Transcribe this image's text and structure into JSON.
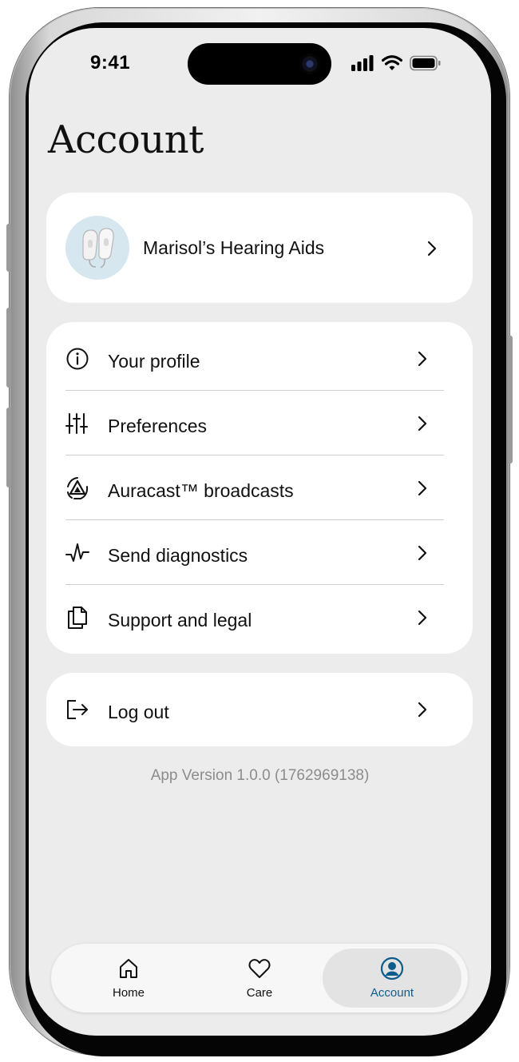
{
  "status_bar": {
    "time": "9:41",
    "icons": [
      "signal-icon",
      "wifi-icon",
      "battery-icon"
    ]
  },
  "header": {
    "title": "Account"
  },
  "device": {
    "name": "Marisol’s Hearing Aids",
    "image": "hearing-aids-image",
    "thumb_color": "#d6e7f0"
  },
  "menu": {
    "items": [
      {
        "label": "Your profile",
        "icon": "info-icon"
      },
      {
        "label": "Preferences",
        "icon": "sliders-icon"
      },
      {
        "label": "Auracast™ broadcasts",
        "icon": "auracast-icon"
      },
      {
        "label": "Send diagnostics",
        "icon": "pulse-icon"
      },
      {
        "label": "Support and legal",
        "icon": "documents-icon"
      }
    ]
  },
  "logout": {
    "label": "Log out",
    "icon": "logout-icon"
  },
  "footer": {
    "version": "App Version 1.0.0 (1762969138)"
  },
  "tabbar": {
    "tabs": [
      {
        "label": "Home",
        "icon": "home-icon",
        "active": false
      },
      {
        "label": "Care",
        "icon": "heart-icon",
        "active": false
      },
      {
        "label": "Account",
        "icon": "account-icon",
        "active": true
      }
    ],
    "accent_color": "#0d5d8c"
  },
  "colors": {
    "background": "#ececec",
    "card": "#ffffff",
    "muted_text": "#8c8c8c"
  }
}
